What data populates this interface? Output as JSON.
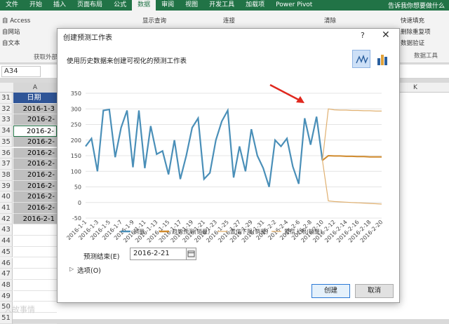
{
  "ribbon": {
    "tabs": [
      "文件",
      "开始",
      "插入",
      "页面布局",
      "公式",
      "数据",
      "审阅",
      "视图",
      "开发工具",
      "加载项",
      "Power Pivot"
    ],
    "active_tab": "数据",
    "tell_me": "告诉我你想要做什么",
    "items": {
      "access": "自 Access",
      "web": "自网站",
      "text": "自文本",
      "get_external": "获取外部",
      "show_query": "显示查询",
      "connect": "连接",
      "clear": "清除",
      "flash_fill": "快速填充",
      "remove_dup": "删除重复项",
      "validate": "数据验证",
      "data_tools": "数据工具"
    }
  },
  "name_box": "A34",
  "columns": {
    "a": "A",
    "k": "K"
  },
  "rows": [
    {
      "num": "31",
      "value": "日期"
    },
    {
      "num": "32",
      "value": "2016-1-3"
    },
    {
      "num": "33",
      "value": "2016-2-"
    },
    {
      "num": "34",
      "value": "2016-2-"
    },
    {
      "num": "35",
      "value": "2016-2-"
    },
    {
      "num": "36",
      "value": "2016-2-"
    },
    {
      "num": "37",
      "value": "2016-2-"
    },
    {
      "num": "38",
      "value": "2016-2-"
    },
    {
      "num": "39",
      "value": "2016-2-"
    },
    {
      "num": "40",
      "value": "2016-2-"
    },
    {
      "num": "41",
      "value": "2016-2-"
    },
    {
      "num": "42",
      "value": "2016-2-1"
    },
    {
      "num": "43",
      "value": ""
    },
    {
      "num": "44",
      "value": ""
    },
    {
      "num": "45",
      "value": ""
    },
    {
      "num": "46",
      "value": ""
    },
    {
      "num": "47",
      "value": ""
    },
    {
      "num": "48",
      "value": ""
    },
    {
      "num": "49",
      "value": ""
    },
    {
      "num": "50",
      "value": ""
    },
    {
      "num": "51",
      "value": ""
    }
  ],
  "dialog": {
    "title": "创建预测工作表",
    "help": "?",
    "close": "✕",
    "description": "使用历史数据来创建可视化的预测工作表",
    "end_label": "预测结束(E)",
    "end_value": "2016-2-21",
    "options_label": "选项(O)",
    "create_label": "创建",
    "cancel_label": "取消"
  },
  "chart_data": {
    "type": "line",
    "ylim": [
      -50,
      350
    ],
    "yticks": [
      -50,
      0,
      50,
      100,
      150,
      200,
      250,
      300,
      350
    ],
    "xtick_labels": [
      "2016-1-1",
      "2016-1-3",
      "2016-1-5",
      "2016-1-7",
      "2016-1-9",
      "2016-1-11",
      "2016-1-13",
      "2016-1-15",
      "2016-1-17",
      "2016-1-19",
      "2016-1-21",
      "2016-1-23",
      "2016-1-25",
      "2016-1-27",
      "2016-1-29",
      "2016-1-31",
      "2016-2-2",
      "2016-2-4",
      "2016-2-6",
      "2016-2-8",
      "2016-2-10",
      "2016-2-12",
      "2016-2-14",
      "2016-2-16",
      "2016-2-18",
      "2016-2-20"
    ],
    "series": [
      {
        "name": "销量",
        "color": "#4a8fb8",
        "x_start": 0,
        "values": [
          180,
          205,
          100,
          295,
          298,
          145,
          240,
          295,
          113,
          295,
          110,
          245,
          155,
          165,
          90,
          200,
          75,
          150,
          240,
          270,
          75,
          95,
          200,
          260,
          295,
          80,
          180,
          100,
          235,
          150,
          110,
          50,
          200,
          180,
          205,
          115,
          60,
          270,
          185,
          275,
          135
        ]
      },
      {
        "name": "趋势预测(销量)",
        "color": "#d08a2c",
        "x_start": 40,
        "values": [
          135,
          150,
          149,
          149,
          148,
          148,
          147,
          147,
          146,
          146,
          146
        ]
      },
      {
        "name": "置信下限(销量)",
        "color": "#e0b070",
        "x_start": 40,
        "values": [
          135,
          5,
          3,
          2,
          1,
          0,
          -1,
          -2,
          -3,
          -4,
          -5
        ]
      },
      {
        "name": "置信上限(销量)",
        "color": "#e0b070",
        "x_start": 40,
        "values": [
          135,
          300,
          297,
          296,
          296,
          295,
          295,
          294,
          294,
          293,
          293
        ]
      }
    ]
  },
  "watermark": "人故事情"
}
